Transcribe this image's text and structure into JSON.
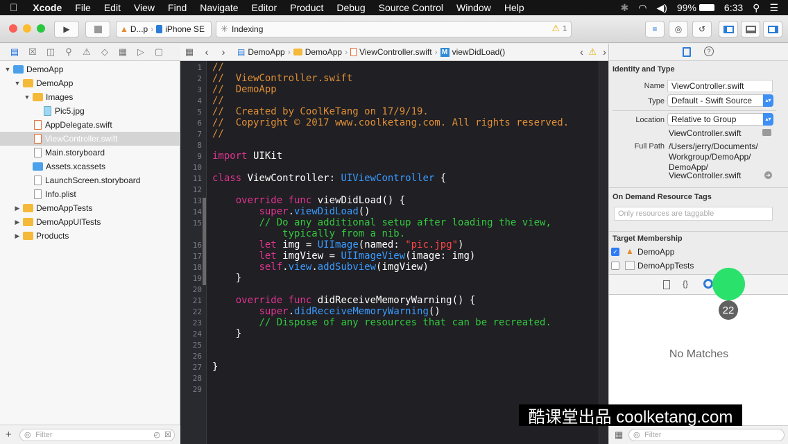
{
  "menubar": {
    "app": "Xcode",
    "items": [
      "File",
      "Edit",
      "View",
      "Find",
      "Navigate",
      "Editor",
      "Product",
      "Debug",
      "Source Control",
      "Window",
      "Help"
    ],
    "battery": "99%",
    "time": "6:33"
  },
  "toolbar": {
    "scheme": "D...p",
    "device": "iPhone SE",
    "activity": "Indexing",
    "warnings": "1"
  },
  "navigator": {
    "tree": [
      {
        "label": "DemoApp",
        "indent": 0,
        "kind": "project",
        "expanded": true
      },
      {
        "label": "DemoApp",
        "indent": 1,
        "kind": "folder",
        "expanded": true
      },
      {
        "label": "Images",
        "indent": 2,
        "kind": "folder",
        "expanded": true
      },
      {
        "label": "Pic5.jpg",
        "indent": 3,
        "kind": "image"
      },
      {
        "label": "AppDelegate.swift",
        "indent": 2,
        "kind": "swift"
      },
      {
        "label": "ViewController.swift",
        "indent": 2,
        "kind": "swift",
        "selected": true
      },
      {
        "label": "Main.storyboard",
        "indent": 2,
        "kind": "file"
      },
      {
        "label": "Assets.xcassets",
        "indent": 2,
        "kind": "blue-folder"
      },
      {
        "label": "LaunchScreen.storyboard",
        "indent": 2,
        "kind": "file"
      },
      {
        "label": "Info.plist",
        "indent": 2,
        "kind": "file"
      },
      {
        "label": "DemoAppTests",
        "indent": 1,
        "kind": "folder",
        "expanded": false
      },
      {
        "label": "DemoAppUITests",
        "indent": 1,
        "kind": "folder",
        "expanded": false
      },
      {
        "label": "Products",
        "indent": 1,
        "kind": "folder",
        "expanded": false
      }
    ],
    "filter_placeholder": "Filter"
  },
  "jumpbar": {
    "crumbs": [
      "DemoApp",
      "DemoApp",
      "ViewController.swift"
    ],
    "method_badge": "M",
    "method": "viewDidLoad()"
  },
  "editor": {
    "line_numbers": [
      "1",
      "2",
      "3",
      "4",
      "5",
      "6",
      "7",
      "8",
      "9",
      "10",
      "11",
      "12",
      "13",
      "14",
      "15",
      "",
      "16",
      "17",
      "18",
      "19",
      "20",
      "21",
      "22",
      "23",
      "24",
      "25",
      "26",
      "27",
      "28",
      "29"
    ],
    "code": [
      [
        [
          "c",
          "//"
        ]
      ],
      [
        [
          "c",
          "//  ViewController.swift"
        ]
      ],
      [
        [
          "c",
          "//  DemoApp"
        ]
      ],
      [
        [
          "c",
          "//"
        ]
      ],
      [
        [
          "c",
          "//  Created by CoolKeTang on 17/9/19."
        ]
      ],
      [
        [
          "c",
          "//  Copyright © 2017 www.coolketang.com. All rights reserved."
        ]
      ],
      [
        [
          "c",
          "//"
        ]
      ],
      [],
      [
        [
          "k",
          "import"
        ],
        [
          "t",
          " UIKit"
        ]
      ],
      [],
      [
        [
          "k",
          "class"
        ],
        [
          "t",
          " ViewController: "
        ],
        [
          "p",
          "UIViewController"
        ],
        [
          "t",
          " {"
        ]
      ],
      [],
      [
        [
          "t",
          "    "
        ],
        [
          "k",
          "override func"
        ],
        [
          "t",
          " viewDidLoad() {"
        ]
      ],
      [
        [
          "t",
          "        "
        ],
        [
          "k",
          "super"
        ],
        [
          "t",
          "."
        ],
        [
          "p",
          "viewDidLoad"
        ],
        [
          "t",
          "()"
        ]
      ],
      [
        [
          "t",
          "        "
        ],
        [
          "g",
          "// Do any additional setup after loading the view,"
        ]
      ],
      [
        [
          "t",
          "            "
        ],
        [
          "g",
          "typically from a nib."
        ]
      ],
      [
        [
          "t",
          "        "
        ],
        [
          "k",
          "let"
        ],
        [
          "t",
          " img = "
        ],
        [
          "p",
          "UIImage"
        ],
        [
          "t",
          "(named: "
        ],
        [
          "s",
          "\"pic.jpg\""
        ],
        [
          "t",
          ")"
        ]
      ],
      [
        [
          "t",
          "        "
        ],
        [
          "k",
          "let"
        ],
        [
          "t",
          " imgView = "
        ],
        [
          "p",
          "UIImageView"
        ],
        [
          "t",
          "(image: img)"
        ]
      ],
      [
        [
          "t",
          "        "
        ],
        [
          "k",
          "self"
        ],
        [
          "t",
          "."
        ],
        [
          "p",
          "view"
        ],
        [
          "t",
          "."
        ],
        [
          "p",
          "addSubview"
        ],
        [
          "t",
          "(imgView)"
        ]
      ],
      [
        [
          "t",
          "    }"
        ]
      ],
      [],
      [
        [
          "t",
          "    "
        ],
        [
          "k",
          "override func"
        ],
        [
          "t",
          " didReceiveMemoryWarning() {"
        ]
      ],
      [
        [
          "t",
          "        "
        ],
        [
          "k",
          "super"
        ],
        [
          "t",
          "."
        ],
        [
          "p",
          "didReceiveMemoryWarning"
        ],
        [
          "t",
          "()"
        ]
      ],
      [
        [
          "t",
          "        "
        ],
        [
          "g",
          "// Dispose of any resources that can be recreated."
        ]
      ],
      [
        [
          "t",
          "    }"
        ]
      ],
      [],
      [],
      [
        [
          "t",
          "}"
        ]
      ],
      [],
      []
    ]
  },
  "inspector": {
    "identity_header": "Identity and Type",
    "name_label": "Name",
    "name_value": "ViewController.swift",
    "type_label": "Type",
    "type_value": "Default - Swift Source",
    "location_label": "Location",
    "location_value": "Relative to Group",
    "location_file": "ViewController.swift",
    "fullpath_label": "Full Path",
    "fullpath_lines": [
      "/Users/jerry/Documents/",
      "Workgroup/DemoApp/",
      "DemoApp/",
      "ViewController.swift"
    ],
    "odr_header": "On Demand Resource Tags",
    "odr_placeholder": "Only resources are taggable",
    "target_header": "Target Membership",
    "targets": [
      {
        "label": "DemoApp",
        "checked": true
      },
      {
        "label": "DemoAppTests",
        "checked": false
      }
    ],
    "library_empty": "No Matches",
    "filter_placeholder": "Filter"
  },
  "overlay": {
    "watermark": "酷课堂出品 coolketang.com",
    "step_number": "22"
  }
}
